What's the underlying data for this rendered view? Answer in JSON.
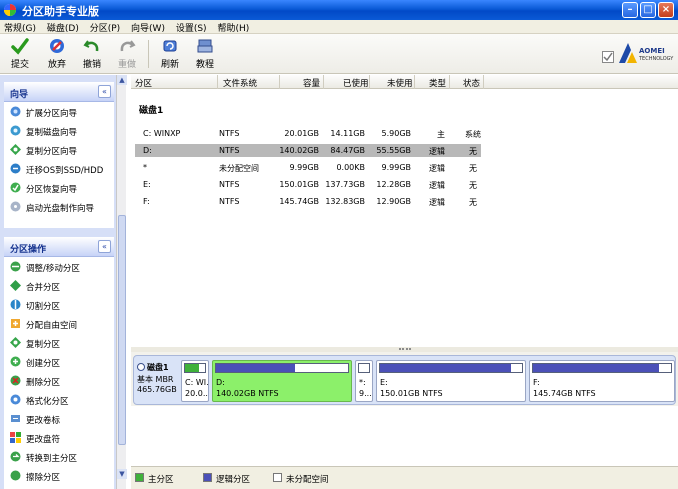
{
  "window": {
    "title": "分区助手专业版"
  },
  "menu": [
    "常规(G)",
    "磁盘(D)",
    "分区(P)",
    "向导(W)",
    "设置(S)",
    "帮助(H)"
  ],
  "toolbar": {
    "commit": "提交",
    "discard": "放弃",
    "undo": "撤销",
    "redo": "重做",
    "refresh": "刷新",
    "tutorial": "教程",
    "brand": "AOMEI",
    "brand_sub": "TECHNOLOGY"
  },
  "wizard_group": {
    "title": "向导",
    "items": [
      "扩展分区向导",
      "复制磁盘向导",
      "复制分区向导",
      "迁移OS到SSD/HDD",
      "分区恢复向导",
      "启动光盘制作向导"
    ]
  },
  "ops_group": {
    "title": "分区操作",
    "items": [
      "调整/移动分区",
      "合并分区",
      "切割分区",
      "分配自由空间",
      "复制分区",
      "创建分区",
      "删除分区",
      "格式化分区",
      "更改卷标",
      "更改盘符",
      "转换到主分区",
      "擦除分区"
    ]
  },
  "columns": [
    "分区",
    "文件系统",
    "容量",
    "已使用",
    "未使用",
    "类型",
    "状态"
  ],
  "disk_label": "磁盘1",
  "rows": [
    {
      "part": "C: WINXP",
      "fs": "NTFS",
      "cap": "20.01GB",
      "used": "14.11GB",
      "free": "5.90GB",
      "type": "主",
      "status": "系统"
    },
    {
      "part": "D:",
      "fs": "NTFS",
      "cap": "140.02GB",
      "used": "84.47GB",
      "free": "55.55GB",
      "type": "逻辑",
      "status": "无"
    },
    {
      "part": "*",
      "fs": "未分配空间",
      "cap": "9.99GB",
      "used": "0.00KB",
      "free": "9.99GB",
      "type": "逻辑",
      "status": "无"
    },
    {
      "part": "E:",
      "fs": "NTFS",
      "cap": "150.01GB",
      "used": "137.73GB",
      "free": "12.28GB",
      "type": "逻辑",
      "status": "无"
    },
    {
      "part": "F:",
      "fs": "NTFS",
      "cap": "145.74GB",
      "used": "132.83GB",
      "free": "12.90GB",
      "type": "逻辑",
      "status": "无"
    }
  ],
  "disk_map": {
    "name": "磁盘1",
    "type": "基本 MBR",
    "size": "465.76GB",
    "parts": [
      {
        "name": "C: WI...",
        "size": "20.0...",
        "used_frac": 0.7,
        "kind": "primary"
      },
      {
        "name": "D:",
        "size": "140.02GB NTFS",
        "used_frac": 0.6,
        "kind": "logical"
      },
      {
        "name": "*:",
        "size": "9...",
        "used_frac": 0,
        "kind": "unallocated"
      },
      {
        "name": "E:",
        "size": "150.01GB NTFS",
        "used_frac": 0.92,
        "kind": "logical"
      },
      {
        "name": "F:",
        "size": "145.74GB NTFS",
        "used_frac": 0.91,
        "kind": "logical"
      }
    ]
  },
  "legend": {
    "primary": "主分区",
    "logical": "逻辑分区",
    "unallocated": "未分配空间"
  },
  "colors": {
    "primary": "#3fb13a",
    "logical": "#4b50b8",
    "unallocated": "#ffffff",
    "selected": "#8cf06a",
    "accent": "#0a5ad6"
  }
}
